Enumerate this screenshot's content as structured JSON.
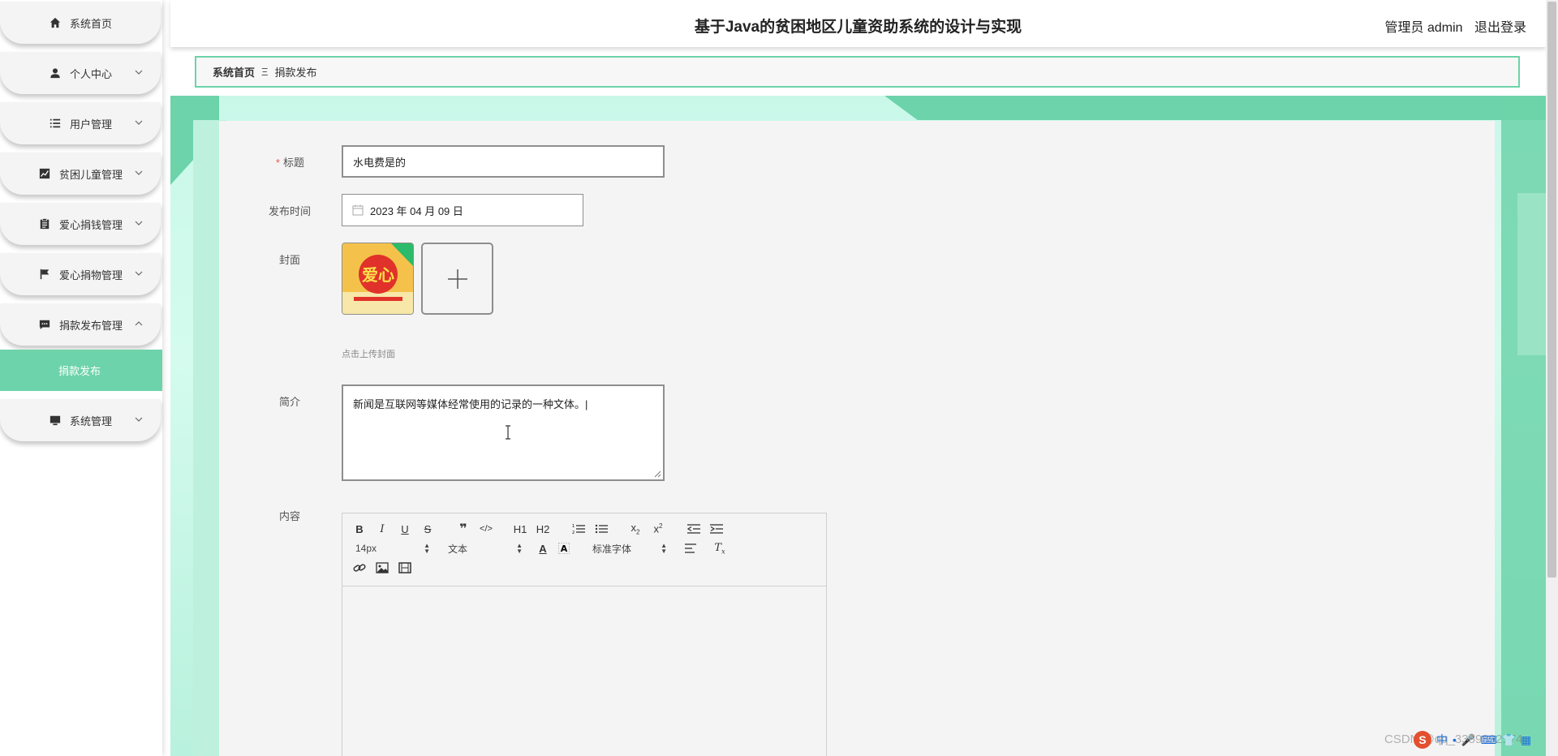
{
  "header": {
    "title": "基于Java的贫困地区儿童资助系统的设计与实现",
    "role": "管理员 admin",
    "logout": "退出登录"
  },
  "sidebar": {
    "items": [
      {
        "label": "系统首页",
        "icon": "home-icon",
        "expandable": false
      },
      {
        "label": "个人中心",
        "icon": "user-icon",
        "expandable": true
      },
      {
        "label": "用户管理",
        "icon": "list-icon",
        "expandable": true
      },
      {
        "label": "贫困儿童管理",
        "icon": "chart-icon",
        "expandable": true
      },
      {
        "label": "爱心捐钱管理",
        "icon": "clipboard-icon",
        "expandable": true
      },
      {
        "label": "爱心捐物管理",
        "icon": "flag-icon",
        "expandable": true
      },
      {
        "label": "捐款发布管理",
        "icon": "message-icon",
        "expandable": true,
        "expanded": true
      },
      {
        "label": "系统管理",
        "icon": "monitor-icon",
        "expandable": true
      }
    ],
    "active_sub": "捐款发布"
  },
  "breadcrumb": {
    "home": "系统首页",
    "separator": "Ξ",
    "current": "捐款发布"
  },
  "form": {
    "title_label": "标题",
    "title_required_mark": "*",
    "title_value": "水电费是的",
    "time_label": "发布时间",
    "time_value": "2023 年 04 月 09 日",
    "cover_label": "封面",
    "cover_tip": "点击上传封面",
    "cover_image_text": "爱心",
    "intro_label": "简介",
    "intro_value": "新闻是互联网等媒体经常使用的记录的一种文体。|",
    "content_label": "内容"
  },
  "editor": {
    "font_size": "14px",
    "heading": "文本",
    "font_family": "标准字体",
    "h1": "H1",
    "h2": "H2"
  },
  "footer": {
    "watermark": "CSDN @qq_3359892174",
    "tray_ime": "中"
  },
  "colors": {
    "accent": "#6dd3aa",
    "background_gradient": "#c9f8e9",
    "card": "#f5f4f4",
    "required": "#e0584c"
  }
}
